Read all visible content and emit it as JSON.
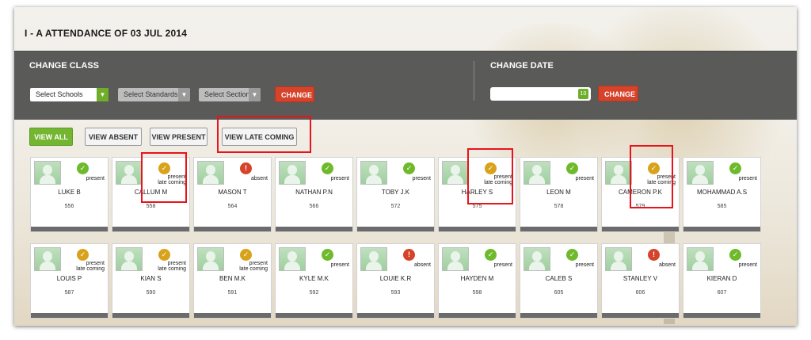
{
  "header": {
    "title": "I - A ATTENDANCE OF 03 JUL 2014"
  },
  "change_class": {
    "heading": "CHANGE CLASS",
    "school_select": "Select Schools",
    "standard_select": "Select Standards",
    "section_select": "Select Section",
    "button": "CHANGE"
  },
  "change_date": {
    "heading": "CHANGE DATE",
    "date_value": "",
    "calendar_icon_text": "10",
    "button": "CHANGE"
  },
  "filters": {
    "view_all": "VIEW ALL",
    "view_absent": "VIEW ABSENT",
    "view_present": "VIEW PRESENT",
    "view_late": "VIEW LATE COMING"
  },
  "status_labels": {
    "present": "present",
    "late": "late coming",
    "absent": "absent"
  },
  "colors": {
    "present": "#6fba2c",
    "late": "#d9a21b",
    "absent": "#d6432b",
    "accent_red": "#d6432b",
    "accent_green": "#74b531",
    "panel": "#5a5a58"
  },
  "students": [
    {
      "name": "LUKE B",
      "roll": "556",
      "status": "present"
    },
    {
      "name": "CALLUM M",
      "roll": "558",
      "status": "late"
    },
    {
      "name": "MASON T",
      "roll": "564",
      "status": "absent"
    },
    {
      "name": "NATHAN P.N",
      "roll": "566",
      "status": "present"
    },
    {
      "name": "TOBY J.K",
      "roll": "572",
      "status": "present"
    },
    {
      "name": "HARLEY S",
      "roll": "575",
      "status": "late"
    },
    {
      "name": "LEON M",
      "roll": "578",
      "status": "present"
    },
    {
      "name": "CAMERON P.K",
      "roll": "579",
      "status": "late"
    },
    {
      "name": "MOHAMMAD A.S",
      "roll": "585",
      "status": "present"
    },
    {
      "name": "LOUIS P",
      "roll": "587",
      "status": "late"
    },
    {
      "name": "KIAN S",
      "roll": "590",
      "status": "late"
    },
    {
      "name": "BEN M.K",
      "roll": "591",
      "status": "late"
    },
    {
      "name": "KYLE M.K",
      "roll": "592",
      "status": "present"
    },
    {
      "name": "LOUIE K.R",
      "roll": "593",
      "status": "absent"
    },
    {
      "name": "HAYDEN M",
      "roll": "598",
      "status": "present"
    },
    {
      "name": "CALEB S",
      "roll": "605",
      "status": "present"
    },
    {
      "name": "STANLEY V",
      "roll": "606",
      "status": "absent"
    },
    {
      "name": "KIERAN D",
      "roll": "607",
      "status": "present"
    }
  ]
}
